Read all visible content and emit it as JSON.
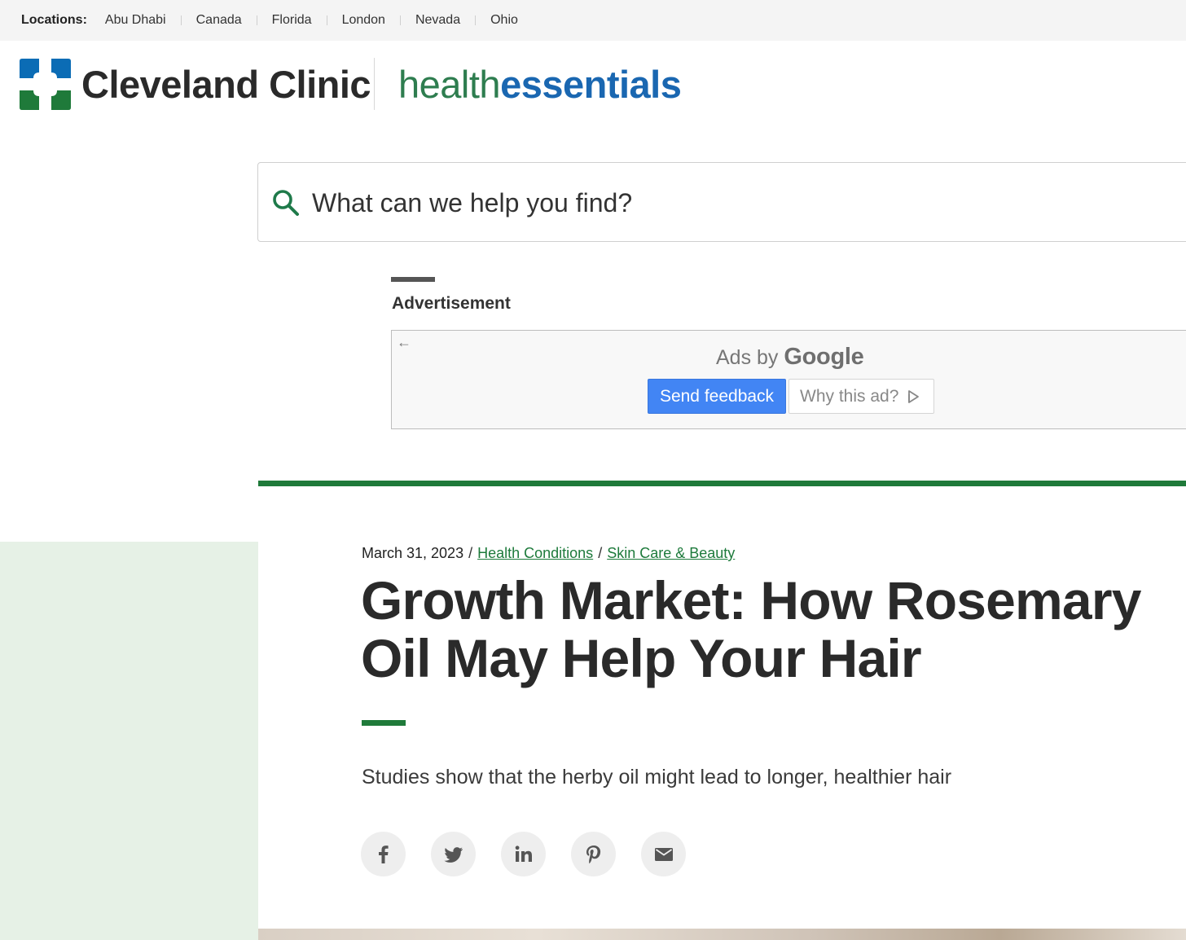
{
  "locations": {
    "label": "Locations:",
    "items": [
      "Abu Dhabi",
      "Canada",
      "Florida",
      "London",
      "Nevada",
      "Ohio"
    ]
  },
  "header": {
    "brand": "Cleveland Clinic",
    "section_health": "health",
    "section_essentials": "essentials"
  },
  "search": {
    "placeholder": "What can we help you find?"
  },
  "advertisement": {
    "label": "Advertisement",
    "ads_by": "Ads by",
    "ads_brand": "Google",
    "send_feedback": "Send feedback",
    "why_this_ad": "Why this ad?"
  },
  "article": {
    "date": "March 31, 2023",
    "separator": "/",
    "category_1": "Health Conditions",
    "category_2": "Skin Care & Beauty",
    "title": "Growth Market: How Rosemary Oil May Help Your Hair",
    "subtitle": "Studies show that the herby oil might lead to longer, healthier hair"
  },
  "share": {
    "icons": [
      "facebook-icon",
      "twitter-icon",
      "linkedin-icon",
      "pinterest-icon",
      "email-icon"
    ]
  },
  "colors": {
    "brand_green": "#1f7a3a",
    "brand_blue": "#1a67b1",
    "link_green": "#1d7a3b",
    "side_tint": "#e6f1e6",
    "google_blue": "#4285f4"
  }
}
